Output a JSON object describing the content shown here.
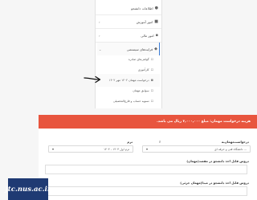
{
  "menu": {
    "items": [
      {
        "label": "اطلاعات دانشجو",
        "icon": "user-icon",
        "chevron": false
      },
      {
        "label": "امور آموزش",
        "icon": "book-icon",
        "chevron": true
      },
      {
        "label": "امور مالی",
        "icon": "wallet-icon",
        "chevron": true
      },
      {
        "label": "فرایندهای سیستمی",
        "icon": "process-icon",
        "chevron": true
      }
    ],
    "subitems": [
      {
        "label": "گواهی‌های صادره",
        "icon": "certificate-icon"
      },
      {
        "label": "کارآموزی",
        "icon": "briefcase-icon"
      },
      {
        "label": "درخواست مهمان ۱۴۰۲ مهر ۱۴۰۲",
        "icon": "guest-icon"
      },
      {
        "label": "سوابق مهمان",
        "icon": "history-icon"
      },
      {
        "label": "تسویه حساب و فارغ‌التحصیلی",
        "icon": "graduation-icon"
      }
    ]
  },
  "alert": {
    "text": "هزینه درخواست مهمان: مبلغ ۲,۰۰۰,۰۰۰ ریال می باشد."
  },
  "form": {
    "unit_label": "درخواست‌مهمان‌به",
    "unit_value": "... دانشگاه فنی و حرفه ای",
    "term_label": "ترم",
    "term_value": "ترم اول ۱۴۰۳ - ۱۴۰۴",
    "field_marker": "لا",
    "dest_courses_label": "دروس قابل اخذ دانشجو در مقصد(مهمان)",
    "partial_courses_label": "دروس قابل اخذ دانشجو در مبدا(مهمان جزئی)"
  },
  "footer": {
    "watermark": "jtc.nus.ac.ir"
  },
  "colors": {
    "alert": "#e8553e",
    "footer": "#1f3a73",
    "accent": "#3a7bd5"
  }
}
